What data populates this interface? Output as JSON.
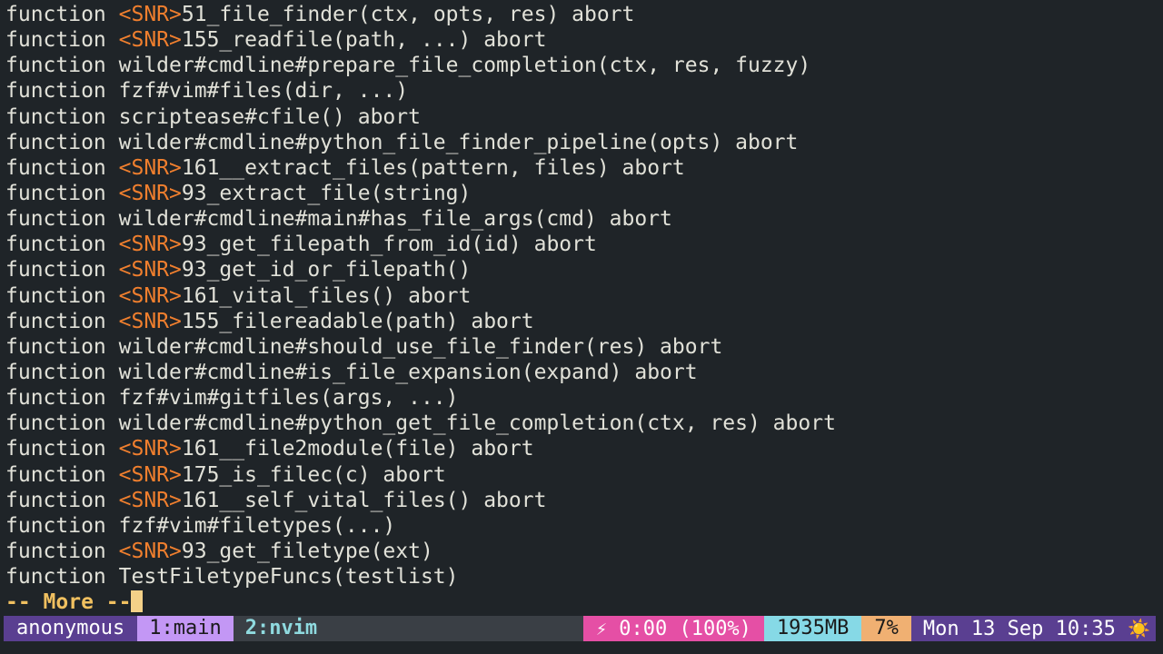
{
  "lines": [
    [
      {
        "t": "function "
      },
      {
        "t": "<SNR>",
        "snr": true
      },
      {
        "t": "51_file_finder(ctx, opts, res) abort"
      }
    ],
    [
      {
        "t": "function "
      },
      {
        "t": "<SNR>",
        "snr": true
      },
      {
        "t": "155_readfile(path, ...) abort"
      }
    ],
    [
      {
        "t": "function wilder#cmdline#prepare_file_completion(ctx, res, fuzzy)"
      }
    ],
    [
      {
        "t": "function fzf#vim#files(dir, ...)"
      }
    ],
    [
      {
        "t": "function scriptease#cfile() abort"
      }
    ],
    [
      {
        "t": "function wilder#cmdline#python_file_finder_pipeline(opts) abort"
      }
    ],
    [
      {
        "t": "function "
      },
      {
        "t": "<SNR>",
        "snr": true
      },
      {
        "t": "161__extract_files(pattern, files) abort"
      }
    ],
    [
      {
        "t": "function "
      },
      {
        "t": "<SNR>",
        "snr": true
      },
      {
        "t": "93_extract_file(string)"
      }
    ],
    [
      {
        "t": "function wilder#cmdline#main#has_file_args(cmd) abort"
      }
    ],
    [
      {
        "t": "function "
      },
      {
        "t": "<SNR>",
        "snr": true
      },
      {
        "t": "93_get_filepath_from_id(id) abort"
      }
    ],
    [
      {
        "t": "function "
      },
      {
        "t": "<SNR>",
        "snr": true
      },
      {
        "t": "93_get_id_or_filepath()"
      }
    ],
    [
      {
        "t": "function "
      },
      {
        "t": "<SNR>",
        "snr": true
      },
      {
        "t": "161_vital_files() abort"
      }
    ],
    [
      {
        "t": "function "
      },
      {
        "t": "<SNR>",
        "snr": true
      },
      {
        "t": "155_filereadable(path) abort"
      }
    ],
    [
      {
        "t": "function wilder#cmdline#should_use_file_finder(res) abort"
      }
    ],
    [
      {
        "t": "function wilder#cmdline#is_file_expansion(expand) abort"
      }
    ],
    [
      {
        "t": "function fzf#vim#gitfiles(args, ...)"
      }
    ],
    [
      {
        "t": "function wilder#cmdline#python_get_file_completion(ctx, res) abort"
      }
    ],
    [
      {
        "t": "function "
      },
      {
        "t": "<SNR>",
        "snr": true
      },
      {
        "t": "161__file2module(file) abort"
      }
    ],
    [
      {
        "t": "function "
      },
      {
        "t": "<SNR>",
        "snr": true
      },
      {
        "t": "175_is_filec(c) abort"
      }
    ],
    [
      {
        "t": "function "
      },
      {
        "t": "<SNR>",
        "snr": true
      },
      {
        "t": "161__self_vital_files() abort"
      }
    ],
    [
      {
        "t": "function fzf#vim#filetypes(...)"
      }
    ],
    [
      {
        "t": "function "
      },
      {
        "t": "<SNR>",
        "snr": true
      },
      {
        "t": "93_get_filetype(ext)"
      }
    ],
    [
      {
        "t": "function TestFiletypeFuncs(testlist)"
      }
    ]
  ],
  "more_prompt": "-- More --",
  "statusbar": {
    "session": "anonymous",
    "window1": "1:main",
    "window2": "2:nvim",
    "battery_icon": "⚡",
    "battery": " 0:00 (100%)",
    "memory": "1935MB",
    "cpu": "7%",
    "clock": "Mon 13 Sep 10:35 ",
    "weather_icon": "☀️"
  },
  "colors": {
    "background": "#1f2428",
    "snr": "#f07f2e",
    "more_prompt": "#f0c060"
  }
}
